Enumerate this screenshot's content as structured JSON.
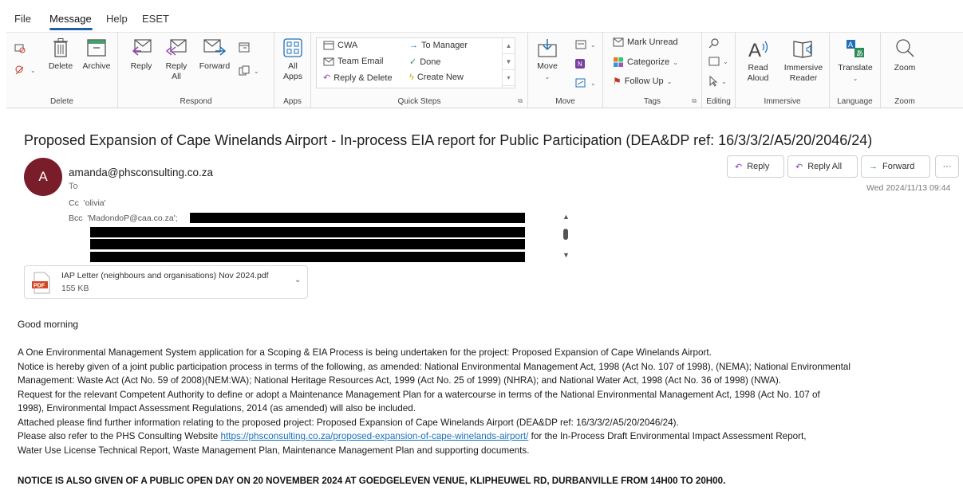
{
  "menu": {
    "items": [
      "File",
      "Message",
      "Help",
      "ESET"
    ],
    "active": "Message"
  },
  "ribbon": {
    "delete_group": {
      "label": "Delete",
      "delete": "Delete",
      "archive": "Archive"
    },
    "respond_group": {
      "label": "Respond",
      "reply": "Reply",
      "reply_all_line1": "Reply",
      "reply_all_line2": "All",
      "forward": "Forward"
    },
    "apps_group": {
      "label": "Apps",
      "all_apps_line1": "All",
      "all_apps_line2": "Apps"
    },
    "quick_steps": {
      "label": "Quick Steps",
      "items": [
        "CWA",
        "To Manager",
        "Team Email",
        "Done",
        "Reply & Delete",
        "Create New"
      ]
    },
    "move_group": {
      "label": "Move",
      "move": "Move"
    },
    "tags_group": {
      "label": "Tags",
      "mark_unread": "Mark Unread",
      "categorize": "Categorize",
      "follow_up": "Follow Up"
    },
    "editing_group": {
      "label": "Editing"
    },
    "immersive_group": {
      "label": "Immersive",
      "read_aloud_line1": "Read",
      "read_aloud_line2": "Aloud",
      "immersive_reader_line1": "Immersive",
      "immersive_reader_line2": "Reader"
    },
    "language_group": {
      "label": "Language",
      "translate": "Translate"
    },
    "zoom_group": {
      "label": "Zoom",
      "zoom": "Zoom"
    }
  },
  "email": {
    "subject": "Proposed Expansion of Cape Winelands Airport - In-process EIA report for Public Participation (DEA&DP ref: 16/3/3/2/A5/20/2046/24)",
    "avatar_initial": "A",
    "sender": "amanda@phsconsulting.co.za",
    "to_label": "To",
    "cc_label": "Cc",
    "cc_value": "'olivia'",
    "bcc_label": "Bcc",
    "bcc_value": "'MadondoP@caa.co.za';",
    "actions": {
      "reply": "Reply",
      "reply_all": "Reply All",
      "forward": "Forward",
      "more": "···"
    },
    "date": "Wed 2024/11/13 09:44",
    "attachment": {
      "name": "IAP Letter (neighbours and organisations) Nov 2024.pdf",
      "size": "155 KB",
      "type_badge": "PDF"
    },
    "greeting": "Good morning",
    "paragraphs": [
      "A One Environmental Management System application for a Scoping & EIA Process is being undertaken for the project: Proposed Expansion of Cape Winelands Airport.",
      "Notice is hereby given of a joint public participation process in terms of the following, as amended:  National Environmental Management Act, 1998 (Act No. 107 of 1998), (NEMA); National Environmental",
      "Management: Waste Act (Act No. 59 of 2008)(NEM:WA); National Heritage Resources Act, 1999 (Act No. 25 of 1999) (NHRA); and National Water Act, 1998 (Act No. 36 of 1998) (NWA).",
      "Request for the relevant Competent Authority to define or adopt a Maintenance Management Plan for a watercourse in terms of the National Environmental Management Act, 1998 (Act No. 107 of",
      "1998), Environmental Impact Assessment Regulations, 2014 (as amended) will also be included.",
      "Attached please find further information relating to the proposed project: Proposed Expansion of Cape Winelands Airport (DEA&DP ref: 16/3/3/2/A5/20/2046/24)."
    ],
    "website_prefix": "Please also refer to the PHS Consulting Website ",
    "website_url": "https://phsconsulting.co.za/proposed-expansion-of-cape-winelands-airport/",
    "website_suffix": " for the In-Process Draft Environmental Impact Assessment Report,",
    "website_line2": "Water Use License Technical Report, Waste Management Plan, Maintenance Management Plan and supporting documents.",
    "notice": "NOTICE IS ALSO GIVEN OF A PUBLIC OPEN DAY ON 20 NOVEMBER 2024 AT GOEDGELEVEN VENUE, KLIPHEUWEL RD, DURBANVILLE FROM 14H00 TO 20H00."
  }
}
